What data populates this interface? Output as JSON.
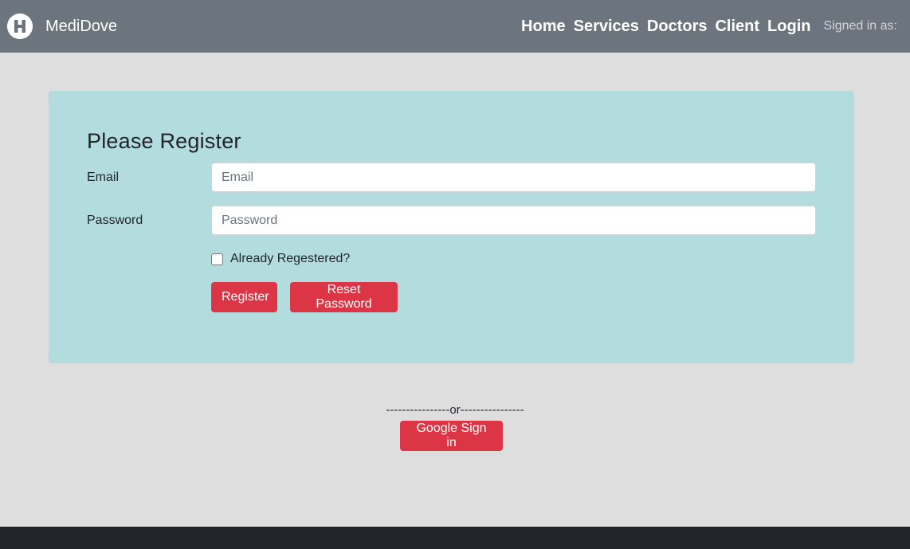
{
  "navbar": {
    "brand": "MediDove",
    "logo_letter": "H",
    "links": [
      "Home",
      "Services",
      "Doctors",
      "Client",
      "Login"
    ],
    "signed_in": "Signed in as:"
  },
  "form": {
    "title": "Please Register",
    "email_label": "Email",
    "email_placeholder": "Email",
    "email_value": "",
    "password_label": "Password",
    "password_placeholder": "Password",
    "password_value": "",
    "checkbox_label": "Already Regestered?",
    "checkbox_checked": false,
    "register_button": "Register",
    "reset_button": "Reset Password"
  },
  "alt": {
    "separator": "----------------or----------------",
    "google_button": "Google Sign in"
  },
  "colors": {
    "navbar": "#6c757d",
    "card": "#b3dcdf",
    "button": "#dc3545",
    "page": "#dedede",
    "footer": "#212529"
  }
}
